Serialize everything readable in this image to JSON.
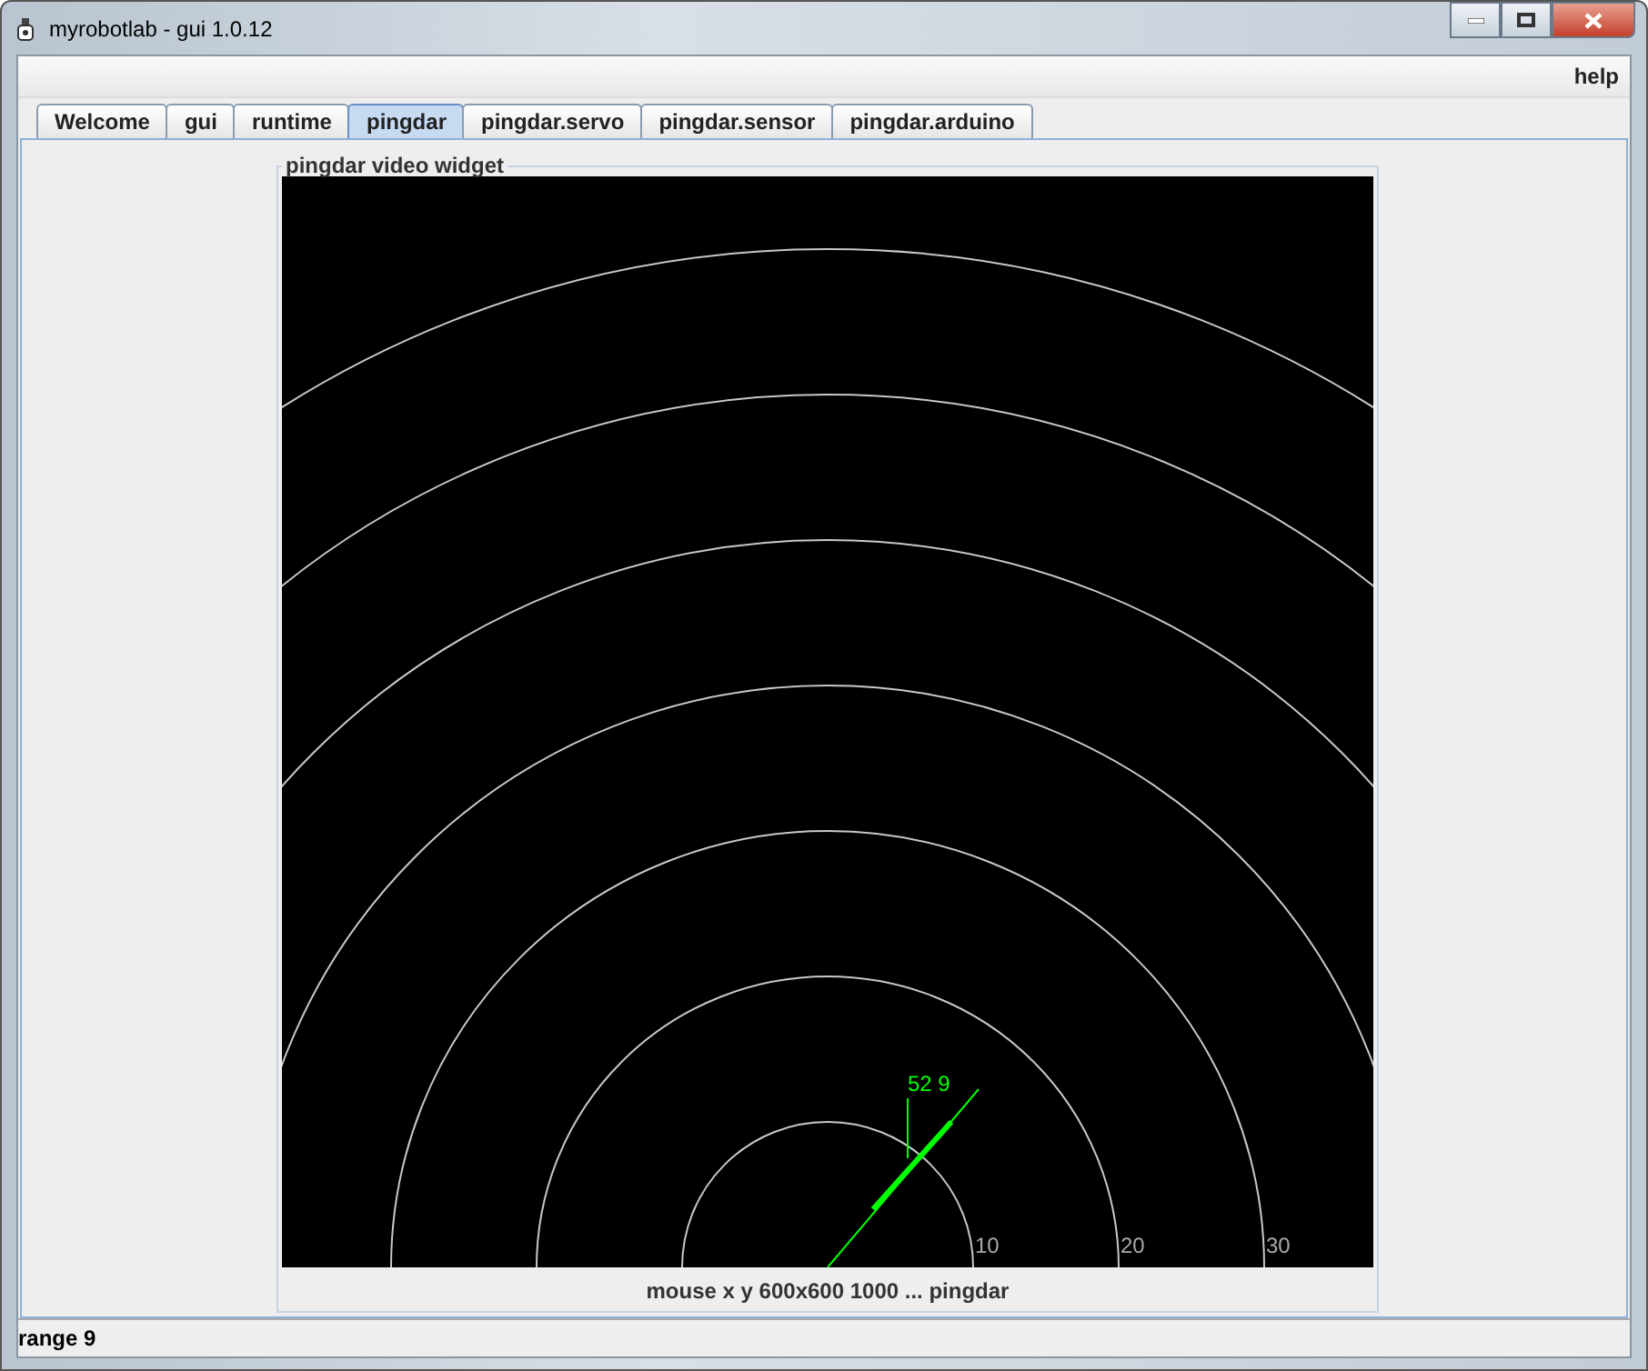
{
  "window": {
    "title": "myrobotlab - gui 1.0.12"
  },
  "menu": {
    "items": [
      "help"
    ]
  },
  "tabs": [
    {
      "label": "Welcome",
      "selected": false
    },
    {
      "label": "gui",
      "selected": false
    },
    {
      "label": "runtime",
      "selected": false
    },
    {
      "label": "pingdar",
      "selected": true
    },
    {
      "label": "pingdar.servo",
      "selected": false
    },
    {
      "label": "pingdar.sensor",
      "selected": false
    },
    {
      "label": "pingdar.arduino",
      "selected": false
    }
  ],
  "video_widget": {
    "title": "pingdar  video widget",
    "range_labels": [
      "10",
      "20",
      "30"
    ],
    "reading": "52 9",
    "caption": "mouse x y  600x600  1000 ...  pingdar"
  },
  "status_bar": {
    "text": "range 9"
  }
}
